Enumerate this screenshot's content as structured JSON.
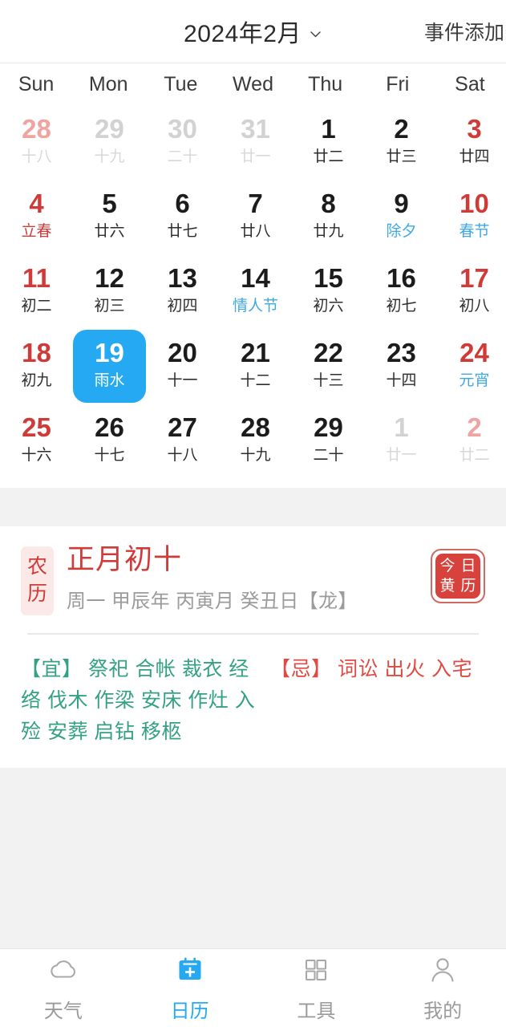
{
  "header": {
    "month_title": "2024年2月",
    "chevron_icon": "chevron-down-icon",
    "add_event_label": "事件添加"
  },
  "weekdays": [
    "Sun",
    "Mon",
    "Tue",
    "Wed",
    "Thu",
    "Fri",
    "Sat"
  ],
  "calendar": {
    "days": [
      {
        "num": "28",
        "sub": "十八",
        "numStyle": "mutedred",
        "subStyle": "muted",
        "selected": false
      },
      {
        "num": "29",
        "sub": "十九",
        "numStyle": "muted",
        "subStyle": "muted",
        "selected": false
      },
      {
        "num": "30",
        "sub": "二十",
        "numStyle": "muted",
        "subStyle": "muted",
        "selected": false
      },
      {
        "num": "31",
        "sub": "廿一",
        "numStyle": "muted",
        "subStyle": "muted",
        "selected": false
      },
      {
        "num": "1",
        "sub": "廿二",
        "numStyle": "",
        "subStyle": "",
        "selected": false
      },
      {
        "num": "2",
        "sub": "廿三",
        "numStyle": "",
        "subStyle": "",
        "selected": false
      },
      {
        "num": "3",
        "sub": "廿四",
        "numStyle": "red",
        "subStyle": "",
        "selected": false
      },
      {
        "num": "4",
        "sub": "立春",
        "numStyle": "red",
        "subStyle": "red",
        "selected": false
      },
      {
        "num": "5",
        "sub": "廿六",
        "numStyle": "",
        "subStyle": "",
        "selected": false
      },
      {
        "num": "6",
        "sub": "廿七",
        "numStyle": "",
        "subStyle": "",
        "selected": false
      },
      {
        "num": "7",
        "sub": "廿八",
        "numStyle": "",
        "subStyle": "",
        "selected": false
      },
      {
        "num": "8",
        "sub": "廿九",
        "numStyle": "",
        "subStyle": "",
        "selected": false
      },
      {
        "num": "9",
        "sub": "除夕",
        "numStyle": "",
        "subStyle": "blue",
        "selected": false
      },
      {
        "num": "10",
        "sub": "春节",
        "numStyle": "red",
        "subStyle": "blue",
        "selected": false
      },
      {
        "num": "11",
        "sub": "初二",
        "numStyle": "red",
        "subStyle": "",
        "selected": false
      },
      {
        "num": "12",
        "sub": "初三",
        "numStyle": "",
        "subStyle": "",
        "selected": false
      },
      {
        "num": "13",
        "sub": "初四",
        "numStyle": "",
        "subStyle": "",
        "selected": false
      },
      {
        "num": "14",
        "sub": "情人节",
        "numStyle": "",
        "subStyle": "blue",
        "selected": false
      },
      {
        "num": "15",
        "sub": "初六",
        "numStyle": "",
        "subStyle": "",
        "selected": false
      },
      {
        "num": "16",
        "sub": "初七",
        "numStyle": "",
        "subStyle": "",
        "selected": false
      },
      {
        "num": "17",
        "sub": "初八",
        "numStyle": "red",
        "subStyle": "",
        "selected": false
      },
      {
        "num": "18",
        "sub": "初九",
        "numStyle": "red",
        "subStyle": "",
        "selected": false
      },
      {
        "num": "19",
        "sub": "雨水",
        "numStyle": "",
        "subStyle": "",
        "selected": true
      },
      {
        "num": "20",
        "sub": "十一",
        "numStyle": "",
        "subStyle": "",
        "selected": false
      },
      {
        "num": "21",
        "sub": "十二",
        "numStyle": "",
        "subStyle": "",
        "selected": false
      },
      {
        "num": "22",
        "sub": "十三",
        "numStyle": "",
        "subStyle": "",
        "selected": false
      },
      {
        "num": "23",
        "sub": "十四",
        "numStyle": "",
        "subStyle": "",
        "selected": false
      },
      {
        "num": "24",
        "sub": "元宵",
        "numStyle": "red",
        "subStyle": "blue",
        "selected": false
      },
      {
        "num": "25",
        "sub": "十六",
        "numStyle": "red",
        "subStyle": "",
        "selected": false
      },
      {
        "num": "26",
        "sub": "十七",
        "numStyle": "",
        "subStyle": "",
        "selected": false
      },
      {
        "num": "27",
        "sub": "十八",
        "numStyle": "",
        "subStyle": "",
        "selected": false
      },
      {
        "num": "28",
        "sub": "十九",
        "numStyle": "",
        "subStyle": "",
        "selected": false
      },
      {
        "num": "29",
        "sub": "二十",
        "numStyle": "",
        "subStyle": "",
        "selected": false
      },
      {
        "num": "1",
        "sub": "廿一",
        "numStyle": "muted",
        "subStyle": "muted",
        "selected": false
      },
      {
        "num": "2",
        "sub": "廿二",
        "numStyle": "mutedred",
        "subStyle": "muted",
        "selected": false
      }
    ]
  },
  "lunar_card": {
    "badge_chars": [
      "农",
      "历"
    ],
    "lunar_date": "正月初十",
    "ganzhi_line": "周一 甲辰年 丙寅月 癸丑日【龙】",
    "huangli_button_chars": [
      "今",
      "日",
      "黄",
      "历"
    ],
    "yi": {
      "tag": "【宜】",
      "items": "祭祀 合帐 裁衣 经络 伐木 作梁 安床 作灶 入殓 安葬 启钻 移柩"
    },
    "ji": {
      "tag": "【忌】",
      "items": "词讼 出火 入宅"
    }
  },
  "tabbar": {
    "items": [
      {
        "label": "天气",
        "icon": "cloud-icon",
        "active": false
      },
      {
        "label": "日历",
        "icon": "calendar-plus-icon",
        "active": true
      },
      {
        "label": "工具",
        "icon": "grid-icon",
        "active": false
      },
      {
        "label": "我的",
        "icon": "person-icon",
        "active": false
      }
    ]
  },
  "colors": {
    "accent_blue": "#24a9f2",
    "festival_red": "#cf3b38",
    "yi_green": "#35a184",
    "ji_red": "#e04a42",
    "muted_gray": "#d2d2d2"
  }
}
